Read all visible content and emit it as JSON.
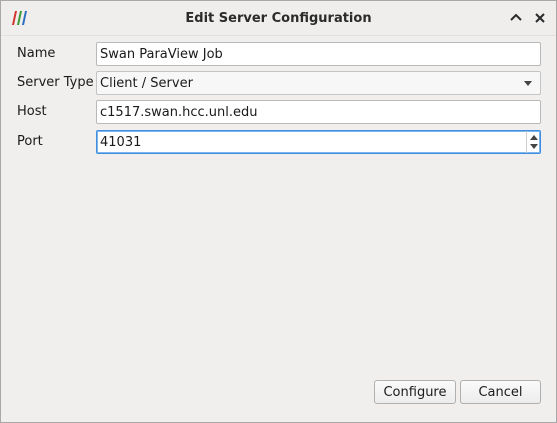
{
  "window": {
    "title": "Edit Server Configuration"
  },
  "form": {
    "name_label": "Name",
    "name_value": "Swan ParaView Job",
    "server_type_label": "Server Type",
    "server_type_value": "Client / Server",
    "host_label": "Host",
    "host_value": "c1517.swan.hcc.unl.edu",
    "port_label": "Port",
    "port_value": "41031"
  },
  "buttons": {
    "configure_label": "Configure",
    "cancel_label": "Cancel"
  },
  "icons": {
    "app": "paraview-logo-icon",
    "titlebar_up": "chevron-up-icon",
    "titlebar_close": "close-icon"
  },
  "colors": {
    "focus_border": "#3d8ee0",
    "logo_red": "#d3342f",
    "logo_green": "#3a9a3a",
    "logo_blue": "#2c6fc0"
  }
}
